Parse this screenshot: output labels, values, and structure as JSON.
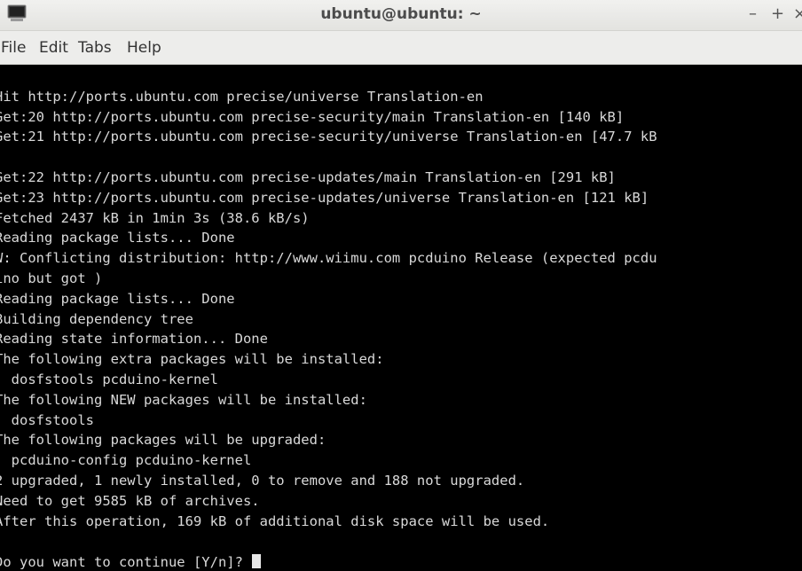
{
  "window": {
    "title": "ubuntu@ubuntu: ~",
    "controls": {
      "minimize": "–",
      "maximize": "+",
      "close": "×"
    },
    "app_icon": "terminal-icon"
  },
  "menubar": {
    "items": [
      "File",
      "Edit",
      "Tabs",
      "Help"
    ]
  },
  "terminal": {
    "background": "#000000",
    "foreground": "#d9d9d9",
    "lines": [
      "]",
      "Hit http://ports.ubuntu.com precise/universe Translation-en",
      "Get:20 http://ports.ubuntu.com precise-security/main Translation-en [140 kB]",
      "Get:21 http://ports.ubuntu.com precise-security/universe Translation-en [47.7 kB",
      "]",
      "Get:22 http://ports.ubuntu.com precise-updates/main Translation-en [291 kB]",
      "Get:23 http://ports.ubuntu.com precise-updates/universe Translation-en [121 kB]",
      "Fetched 2437 kB in 1min 3s (38.6 kB/s)",
      "Reading package lists... Done",
      "W: Conflicting distribution: http://www.wiimu.com pcduino Release (expected pcdu",
      "ino but got )",
      "Reading package lists... Done",
      "Building dependency tree",
      "Reading state information... Done",
      "The following extra packages will be installed:",
      "  dosfstools pcduino-kernel",
      "The following NEW packages will be installed:",
      "  dosfstools",
      "The following packages will be upgraded:",
      "  pcduino-config pcduino-kernel",
      "2 upgraded, 1 newly installed, 0 to remove and 188 not upgraded.",
      "Need to get 9585 kB of archives.",
      "After this operation, 169 kB of additional disk space will be used."
    ],
    "prompt": "Do you want to continue [Y/n]? "
  }
}
